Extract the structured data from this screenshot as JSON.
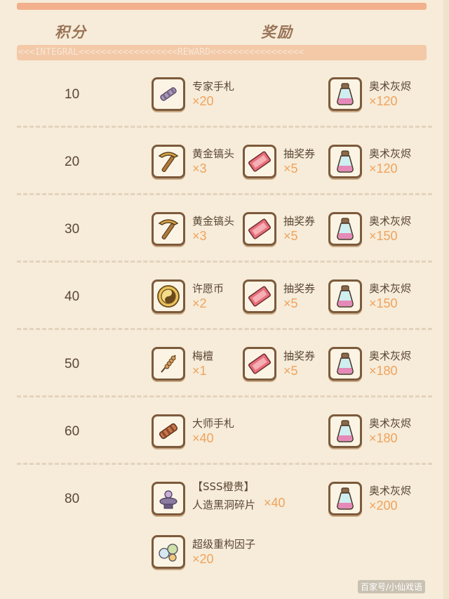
{
  "header": {
    "integral_title": "积分",
    "reward_title": "奖励",
    "banner_left": "<<<INTEGRAL<<<<<<<<<<<<<<<<<<REWARD<<<<<<<<<<<<<<<<<",
    "banner_pad": "<<<<<<<<<<<<<<<<<<<<<<<<<<<<<<<<<<<<<<<<<<<<<<<<<<<<<<<<"
  },
  "colors": {
    "background": "#f6ecd9",
    "accent_qty": "#f0a35e",
    "icon_border": "#7c5a3c"
  },
  "rows": [
    {
      "score": "10",
      "c1": {
        "name": "专家手札",
        "qty": "×20",
        "icon": "expert-notes-icon"
      },
      "c3": {
        "name": "奥术灰烬",
        "qty": "×120",
        "icon": "arcane-ash-potion-icon"
      }
    },
    {
      "score": "20",
      "c1": {
        "name": "黄金镐头",
        "qty": "×3",
        "icon": "golden-pickaxe-icon"
      },
      "c2": {
        "name": "抽奖券",
        "qty": "×5",
        "icon": "lottery-ticket-icon"
      },
      "c3": {
        "name": "奥术灰烬",
        "qty": "×120",
        "icon": "arcane-ash-potion-icon"
      }
    },
    {
      "score": "30",
      "c1": {
        "name": "黄金镐头",
        "qty": "×3",
        "icon": "golden-pickaxe-icon"
      },
      "c2": {
        "name": "抽奖券",
        "qty": "×5",
        "icon": "lottery-ticket-icon"
      },
      "c3": {
        "name": "奥术灰烬",
        "qty": "×150",
        "icon": "arcane-ash-potion-icon"
      }
    },
    {
      "score": "40",
      "c1": {
        "name": "许愿币",
        "qty": "×2",
        "icon": "wish-coin-icon"
      },
      "c2": {
        "name": "抽奖券",
        "qty": "×5",
        "icon": "lottery-ticket-icon"
      },
      "c3": {
        "name": "奥术灰烬",
        "qty": "×150",
        "icon": "arcane-ash-potion-icon"
      }
    },
    {
      "score": "50",
      "c1": {
        "name": "梅檀",
        "qty": "×1",
        "icon": "sandalwood-stick-icon"
      },
      "c2": {
        "name": "抽奖券",
        "qty": "×5",
        "icon": "lottery-ticket-icon"
      },
      "c3": {
        "name": "奥术灰烬",
        "qty": "×180",
        "icon": "arcane-ash-potion-icon"
      }
    },
    {
      "score": "60",
      "c1": {
        "name": "大师手札",
        "qty": "×40",
        "icon": "master-notes-icon"
      },
      "c3": {
        "name": "奥术灰烬",
        "qty": "×180",
        "icon": "arcane-ash-potion-icon"
      }
    },
    {
      "score": "80",
      "c1": {
        "name": "【SSS橙贵】",
        "name2": "人造黑洞碎片",
        "qty": "×40",
        "icon": "black-hole-fragment-icon"
      },
      "c3": {
        "name": "奥术灰烬",
        "qty": "×200",
        "icon": "arcane-ash-potion-icon"
      },
      "extra": {
        "name": "超级重构因子",
        "qty": "×20",
        "icon": "super-restructure-factor-icon"
      }
    }
  ],
  "watermark": "百家号/小仙戏语"
}
